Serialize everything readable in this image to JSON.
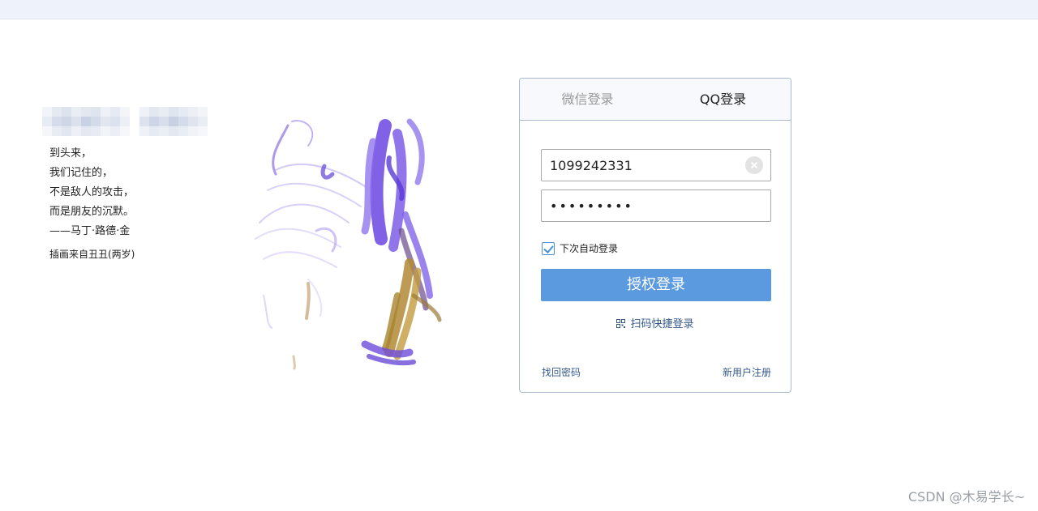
{
  "quote": {
    "lines": [
      "到头来，",
      "我们记住的，",
      "不是敌人的攻击，",
      "而是朋友的沉默。",
      "——马丁·路德·金"
    ],
    "credit": "插画来自丑丑(两岁)"
  },
  "login": {
    "tabs": [
      {
        "label": "微信登录",
        "active": false
      },
      {
        "label": "QQ登录",
        "active": true
      }
    ],
    "username_value": "1099242331",
    "password_mask": "•••••••••",
    "remember_label": "下次自动登录",
    "remember_checked": true,
    "submit_label": "授权登录",
    "qr_label": "扫码快捷登录",
    "forgot_label": "找回密码",
    "register_label": "新用户注册"
  },
  "watermark": "CSDN @木易学长~",
  "colors": {
    "accent": "#5b9ade",
    "link": "#355a8a",
    "border": "#a9b8cc",
    "topbar": "#eef2fa"
  }
}
